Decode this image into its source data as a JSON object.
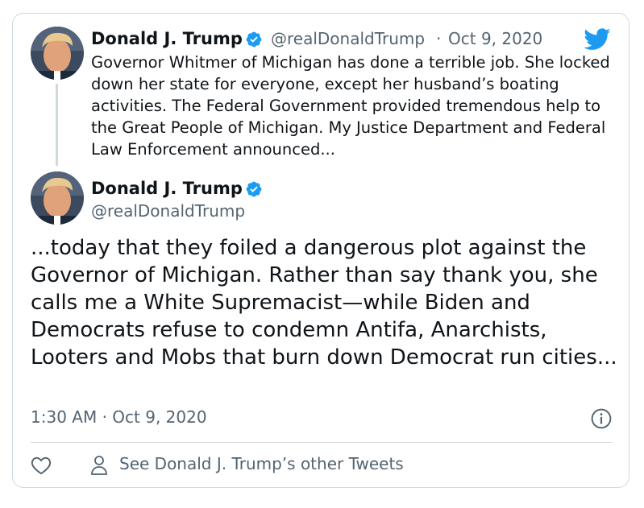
{
  "tweet1": {
    "name": "Donald J. Trump",
    "handle": "@realDonaldTrump",
    "separator": "·",
    "date": "Oct 9, 2020",
    "text": "Governor Whitmer of Michigan has done a terrible job. She locked down her state for everyone, except her husband’s boating activities. The Federal Government provided tremendous help to the Great People of Michigan. My Justice Department and Federal Law Enforcement announced..."
  },
  "tweet2": {
    "name": "Donald J. Trump",
    "handle": "@realDonaldTrump",
    "text": "...today that they foiled a dangerous plot against the Governor of Michigan. Rather than say thank you, she calls me a White Supremacist—while Biden and Democrats refuse to condemn Antifa, Anarchists, Looters and Mobs that burn down Democrat run cities...",
    "timestamp": "1:30 AM · Oct 9, 2020"
  },
  "footer": {
    "other_tweets_label": "See Donald J. Trump’s other Tweets"
  },
  "icons": {
    "logo": "twitter-bird-icon",
    "verified": "verified-badge-icon",
    "info": "info-icon",
    "like": "heart-icon",
    "profile": "person-icon"
  },
  "colors": {
    "twitter_blue": "#1d9bf0",
    "text_primary": "#0f1419",
    "text_secondary": "#536471",
    "border": "#cfd9de"
  }
}
